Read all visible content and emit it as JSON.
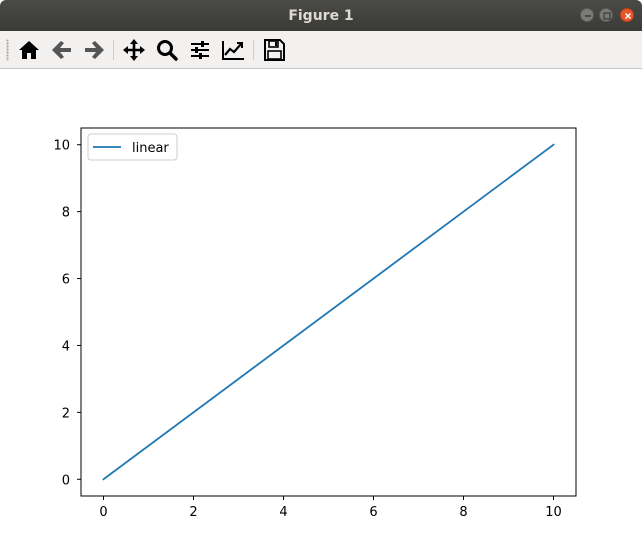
{
  "window": {
    "title": "Figure 1"
  },
  "toolbar": {
    "buttons": [
      {
        "name": "home",
        "icon": "home-icon"
      },
      {
        "name": "back",
        "icon": "arrow-left-icon"
      },
      {
        "name": "forward",
        "icon": "arrow-right-icon"
      },
      {
        "name": "pan",
        "icon": "move-icon"
      },
      {
        "name": "zoom",
        "icon": "magnifier-icon"
      },
      {
        "name": "subplots",
        "icon": "sliders-icon"
      },
      {
        "name": "edit-axes",
        "icon": "chart-line-icon"
      },
      {
        "name": "save",
        "icon": "floppy-disk-icon"
      }
    ]
  },
  "chart_data": {
    "type": "line",
    "title": "",
    "xlabel": "",
    "ylabel": "",
    "xlim": [
      -0.5,
      10.5
    ],
    "ylim": [
      -0.5,
      10.5
    ],
    "xticks": [
      "0",
      "2",
      "4",
      "6",
      "8",
      "10"
    ],
    "yticks": [
      "0",
      "2",
      "4",
      "6",
      "8",
      "10"
    ],
    "grid": false,
    "legend_placement": "upper-left",
    "series": [
      {
        "name": "linear",
        "color": "#1f77b4",
        "x": [
          0,
          10
        ],
        "y": [
          0,
          10
        ]
      }
    ]
  }
}
